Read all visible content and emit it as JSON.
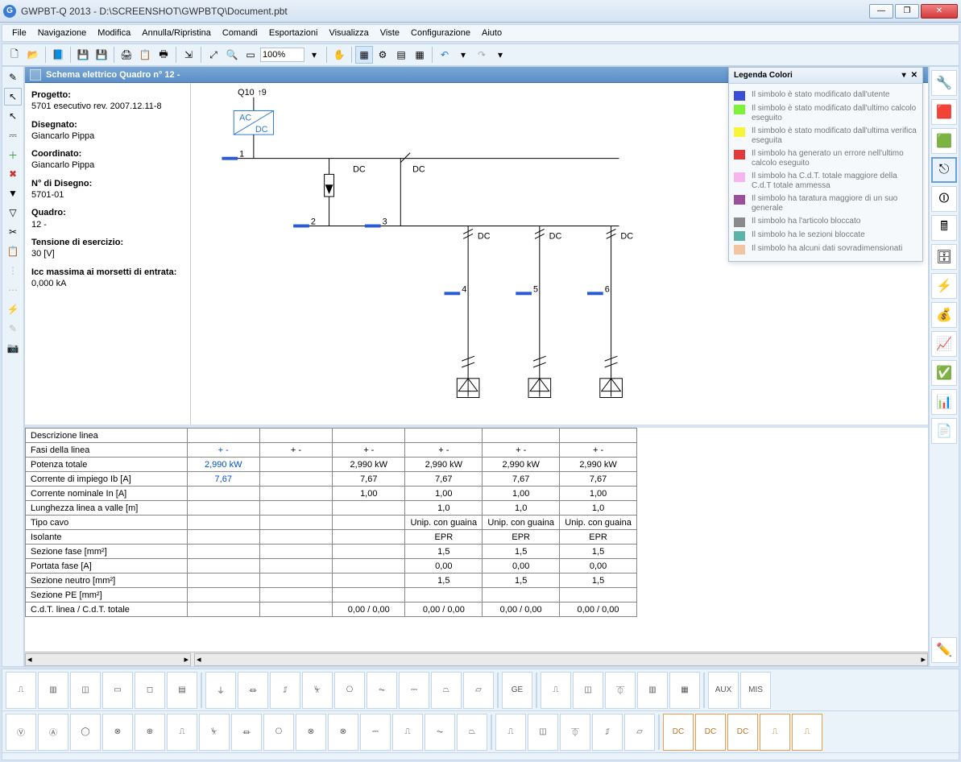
{
  "window": {
    "title": "GWPBT-Q 2013 - D:\\SCREENSHOT\\GWPBTQ\\Document.pbt",
    "app_icon_letter": "G"
  },
  "menu": [
    "File",
    "Navigazione",
    "Modifica",
    "Annulla/Ripristina",
    "Comandi",
    "Esportazioni",
    "Visualizza",
    "Viste",
    "Configurazione",
    "Aiuto"
  ],
  "toolbar": {
    "zoom": "100%"
  },
  "schema_title": "Schema elettrico Quadro n° 12 -",
  "info": {
    "progetto_lbl": "Progetto:",
    "progetto_val": "5701 esecutivo rev. 2007.12.11-8",
    "disegnato_lbl": "Disegnato:",
    "disegnato_val": "Giancarlo Pippa",
    "coordinato_lbl": "Coordinato:",
    "coordinato_val": "Giancarlo Pippa",
    "ndisegno_lbl": "N° di Disegno:",
    "ndisegno_val": "5701-01",
    "quadro_lbl": "Quadro:",
    "quadro_val": "12 -",
    "tensione_lbl": "Tensione di esercizio:",
    "tensione_val": "30 [V]",
    "icc_lbl": "Icc massima ai morsetti di entrata:",
    "icc_val": "0,000 kA"
  },
  "diagram": {
    "q10": "Q10",
    "q10_num": "9",
    "acdc_top": "AC",
    "acdc_bot": "DC",
    "dc": "DC",
    "nodes": [
      "1",
      "2",
      "3",
      "4",
      "5",
      "6"
    ]
  },
  "table": {
    "rows": [
      {
        "label": "Descrizione linea",
        "cells": [
          "",
          "",
          "",
          "",
          "",
          ""
        ]
      },
      {
        "label": "Fasi della linea",
        "cells": [
          "+ -",
          "+ -",
          "+ -",
          "+ -",
          "+ -",
          "+ -"
        ],
        "blue0": true
      },
      {
        "label": "Potenza totale",
        "cells": [
          "2,990 kW",
          "",
          "2,990 kW",
          "2,990 kW",
          "2,990 kW",
          "2,990 kW"
        ],
        "blue0": true
      },
      {
        "label": "Corrente di impiego Ib [A]",
        "cells": [
          "7,67",
          "",
          "7,67",
          "7,67",
          "7,67",
          "7,67"
        ],
        "blue0": true
      },
      {
        "label": "Corrente nominale In [A]",
        "cells": [
          "",
          "",
          "1,00",
          "1,00",
          "1,00",
          "1,00"
        ]
      },
      {
        "label": "Lunghezza linea a valle [m]",
        "cells": [
          "",
          "",
          "",
          "1,0",
          "1,0",
          "1,0"
        ]
      },
      {
        "label": "Tipo cavo",
        "cells": [
          "",
          "",
          "",
          "Unip. con guaina",
          "Unip. con guaina",
          "Unip. con guaina"
        ]
      },
      {
        "label": "Isolante",
        "cells": [
          "",
          "",
          "",
          "EPR",
          "EPR",
          "EPR"
        ]
      },
      {
        "label": "Sezione fase [mm²]",
        "cells": [
          "",
          "",
          "",
          "1,5",
          "1,5",
          "1,5"
        ]
      },
      {
        "label": "Portata fase [A]",
        "cells": [
          "",
          "",
          "",
          "0,00",
          "0,00",
          "0,00"
        ]
      },
      {
        "label": "Sezione neutro [mm²]",
        "cells": [
          "",
          "",
          "",
          "1,5",
          "1,5",
          "1,5"
        ]
      },
      {
        "label": "Sezione PE [mm²]",
        "cells": [
          "",
          "",
          "",
          "",
          "",
          ""
        ]
      },
      {
        "label": "C.d.T. linea / C.d.T. totale",
        "cells": [
          "",
          "",
          "0,00 / 0,00",
          "0,00 / 0,00",
          "0,00 / 0,00",
          "0,00 / 0,00"
        ]
      }
    ]
  },
  "legend": {
    "title": "Legenda Colori",
    "items": [
      {
        "c": "#3a4fd8",
        "t": "Il simbolo è stato modificato dall'utente"
      },
      {
        "c": "#7ef23a",
        "t": "Il simbolo è stato modificato dall'ultimo calcolo eseguito"
      },
      {
        "c": "#f6f53a",
        "t": "Il simbolo è stato modificato dall'ultima verifica eseguita"
      },
      {
        "c": "#e23a3a",
        "t": "Il simbolo ha generato un errore nell'ultimo calcolo eseguito"
      },
      {
        "c": "#f5b6f0",
        "t": "Il simbolo ha C.d.T. totale maggiore della C.d.T totale ammessa"
      },
      {
        "c": "#9a4f9a",
        "t": "Il simbolo ha taratura maggiore di un suo generale"
      },
      {
        "c": "#8a8a8a",
        "t": "Il simbolo ha l'articolo bloccato"
      },
      {
        "c": "#5ab5a8",
        "t": "Il simbolo ha le sezioni bloccate"
      },
      {
        "c": "#f2c4a0",
        "t": "Il simbolo ha alcuni dati sovradimensionati"
      }
    ]
  }
}
